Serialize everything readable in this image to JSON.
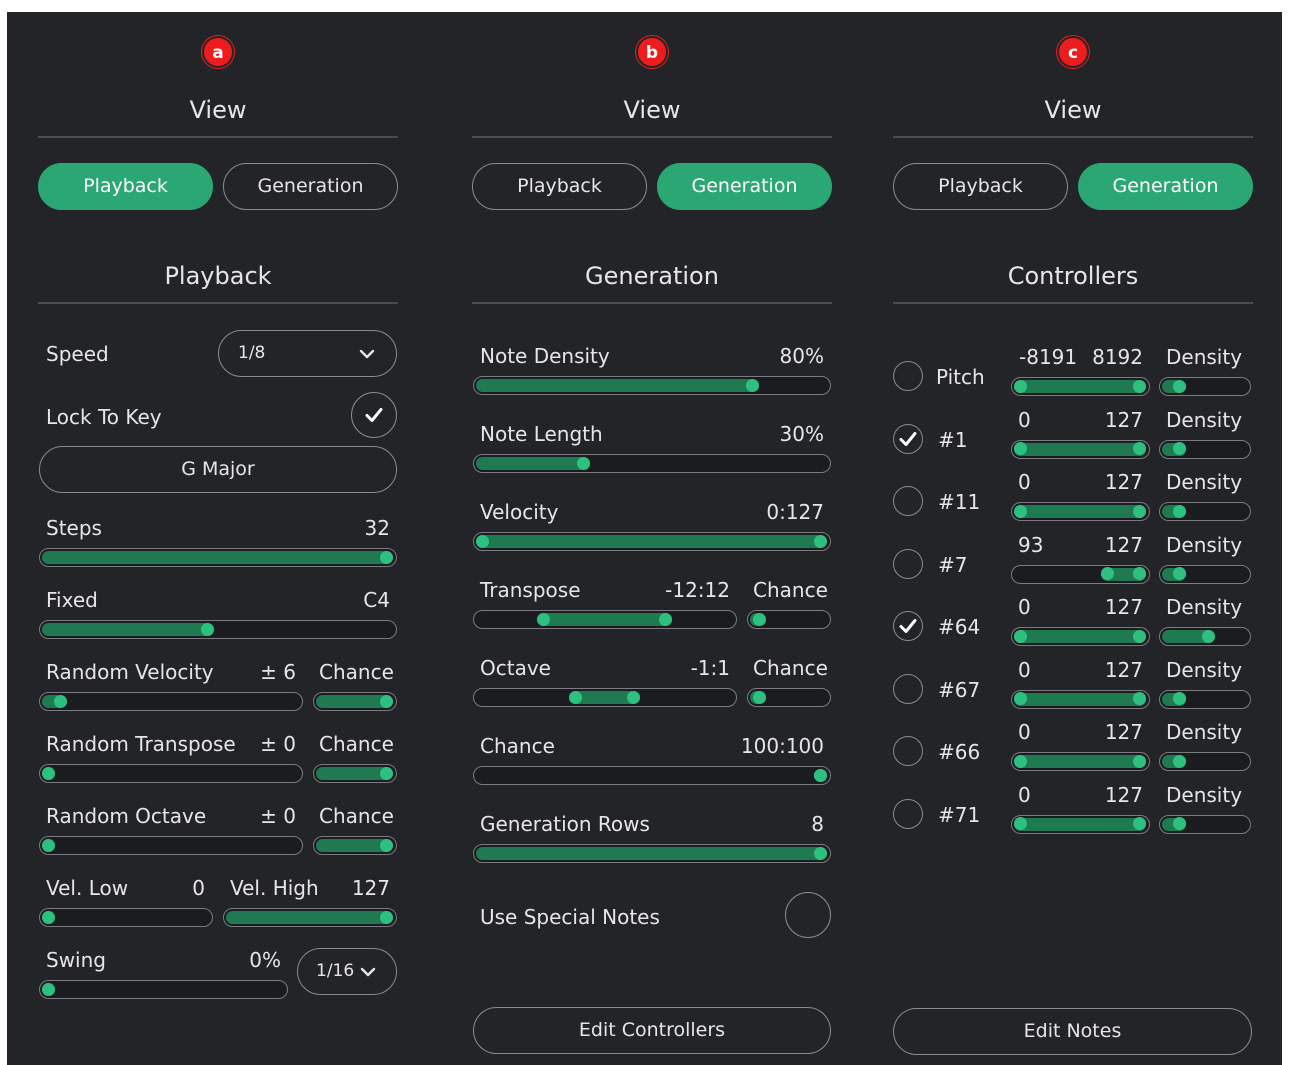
{
  "colors": {
    "background": "#232427",
    "accent": "#2aa773",
    "track_fill": "#1f7a52",
    "knob": "#2ec07e",
    "badge": "#ee1c1c"
  },
  "panel_a": {
    "badge": "a",
    "view_title": "View",
    "tabs": {
      "playback": "Playback",
      "generation": "Generation",
      "active": "Playback"
    },
    "section_title": "Playback",
    "speed": {
      "label": "Speed",
      "value": "1/8"
    },
    "lock_to_key": {
      "label": "Lock To Key",
      "checked": true,
      "key": "G Major"
    },
    "steps": {
      "label": "Steps",
      "value": "32",
      "level": 1.0
    },
    "fixed": {
      "label": "Fixed",
      "value": "C4",
      "level": 0.47
    },
    "random_velocity": {
      "label": "Random Velocity",
      "value": "± 6",
      "chance_label": "Chance",
      "level": 0.05,
      "chance_level": 1.0
    },
    "random_transpose": {
      "label": "Random Transpose",
      "value": "± 0",
      "chance_label": "Chance",
      "level": 0.0,
      "chance_level": 1.0
    },
    "random_octave": {
      "label": "Random Octave",
      "value": "± 0",
      "chance_label": "Chance",
      "level": 0.0,
      "chance_level": 1.0
    },
    "vel_low": {
      "label": "Vel. Low",
      "value": "0",
      "level": 0.0
    },
    "vel_high": {
      "label": "Vel. High",
      "value": "127",
      "level": 1.0
    },
    "swing": {
      "label": "Swing",
      "value": "0%",
      "division": "1/16",
      "level": 0.0
    }
  },
  "panel_b": {
    "badge": "b",
    "view_title": "View",
    "tabs": {
      "playback": "Playback",
      "generation": "Generation",
      "active": "Generation"
    },
    "section_title": "Generation",
    "note_density": {
      "label": "Note Density",
      "value": "80%",
      "level": 0.8
    },
    "note_length": {
      "label": "Note Length",
      "value": "30%",
      "level": 0.3
    },
    "velocity": {
      "label": "Velocity",
      "value": "0:127",
      "range": [
        0,
        1
      ]
    },
    "transpose": {
      "label": "Transpose",
      "value": "-12:12",
      "chance_label": "Chance",
      "range": [
        0.25,
        0.75
      ],
      "chance_level": 0.05
    },
    "octave": {
      "label": "Octave",
      "value": "-1:1",
      "chance_label": "Chance",
      "range": [
        0.38,
        0.62
      ],
      "chance_level": 0.05
    },
    "chance": {
      "label": "Chance",
      "value": "100:100",
      "range": [
        1,
        1
      ]
    },
    "generation_rows": {
      "label": "Generation Rows",
      "value": "8",
      "level": 1.0
    },
    "use_special_notes": {
      "label": "Use Special Notes",
      "checked": false
    },
    "edit_button": "Edit Controllers"
  },
  "panel_c": {
    "badge": "c",
    "view_title": "View",
    "tabs": {
      "playback": "Playback",
      "generation": "Generation",
      "active": "Generation"
    },
    "section_title": "Controllers",
    "controllers": [
      {
        "name": "Pitch",
        "checked": false,
        "min": "-8191",
        "max": "8192",
        "density_label": "Density",
        "range": [
          0,
          1
        ],
        "density": 0.15
      },
      {
        "name": "#1",
        "checked": true,
        "min": "0",
        "max": "127",
        "density_label": "Density",
        "range": [
          0,
          1
        ],
        "density": 0.15
      },
      {
        "name": "#11",
        "checked": false,
        "min": "0",
        "max": "127",
        "density_label": "Density",
        "range": [
          0,
          1
        ],
        "density": 0.15
      },
      {
        "name": "#7",
        "checked": false,
        "min": "93",
        "max": "127",
        "density_label": "Density",
        "range": [
          0.73,
          1
        ],
        "density": 0.15
      },
      {
        "name": "#64",
        "checked": true,
        "min": "0",
        "max": "127",
        "density_label": "Density",
        "range": [
          0,
          1
        ],
        "density": 0.55
      },
      {
        "name": "#67",
        "checked": false,
        "min": "0",
        "max": "127",
        "density_label": "Density",
        "range": [
          0,
          1
        ],
        "density": 0.15
      },
      {
        "name": "#66",
        "checked": false,
        "min": "0",
        "max": "127",
        "density_label": "Density",
        "range": [
          0,
          1
        ],
        "density": 0.15
      },
      {
        "name": "#71",
        "checked": false,
        "min": "0",
        "max": "127",
        "density_label": "Density",
        "range": [
          0,
          1
        ],
        "density": 0.15
      }
    ],
    "edit_button": "Edit Notes"
  }
}
